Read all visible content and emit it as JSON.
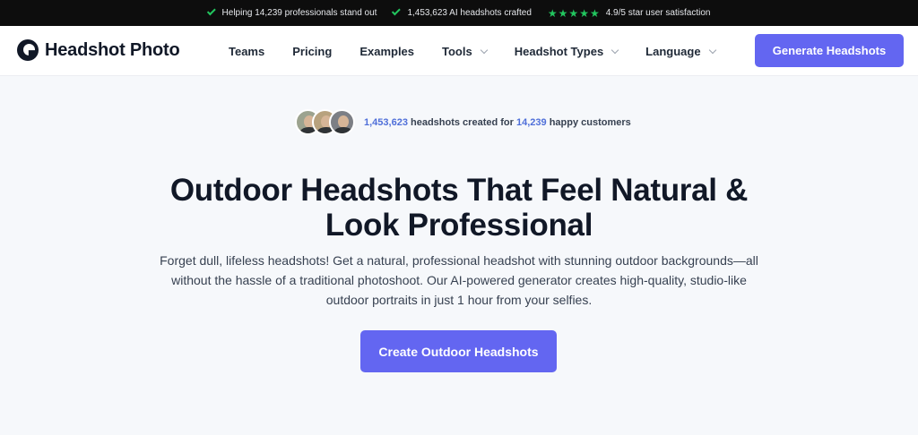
{
  "topbar": {
    "item1": "Helping 14,239 professionals stand out",
    "item2": "1,453,623 AI headshots crafted",
    "rating_stars": 5,
    "item3": "4.9/5 star user satisfaction"
  },
  "header": {
    "logo_text": "Headshot Photo",
    "nav": [
      {
        "label": "Teams"
      },
      {
        "label": "Pricing"
      },
      {
        "label": "Examples"
      },
      {
        "label": "Tools"
      },
      {
        "label": "Headshot Types"
      },
      {
        "label": "Language"
      }
    ],
    "cta": "Generate Headshots"
  },
  "hero": {
    "proof": {
      "count": "1,453,623",
      "middle": " headshots created for ",
      "customers": "14,239",
      "end": " happy customers"
    },
    "headline_line1": "Outdoor Headshots That Feel Natural &",
    "headline_line2": "Look Professional",
    "subtitle": "Forget dull, lifeless headshots! Get a natural, professional headshot with stunning outdoor backgrounds—all without the hassle of a traditional photoshoot. Our AI-powered generator creates high-quality, studio-like outdoor portraits in just 1 hour from your selfies.",
    "cta": "Create Outdoor Headshots"
  },
  "colors": {
    "accent": "#6366f1",
    "check": "#22c55e",
    "highlight": "#4f6fd9"
  }
}
